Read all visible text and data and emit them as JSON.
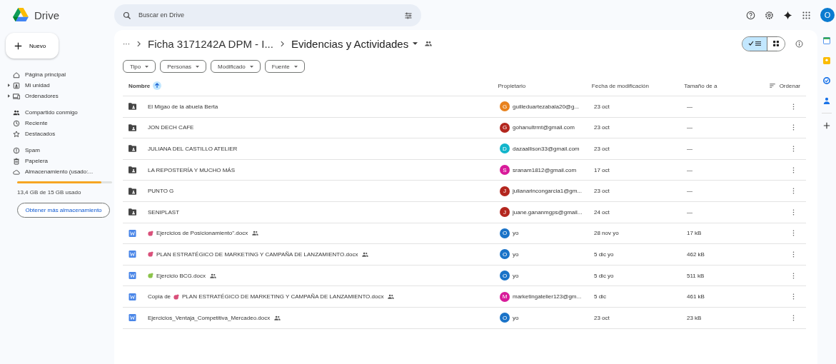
{
  "app": {
    "name": "Drive"
  },
  "search": {
    "placeholder": "Buscar en Drive"
  },
  "account": {
    "initial": "O"
  },
  "new_button": {
    "label": "Nuevo"
  },
  "sidebar": {
    "items": [
      {
        "label": "Página principal",
        "expandable": false
      },
      {
        "label": "Mi unidad",
        "expandable": true
      },
      {
        "label": "Ordenadores",
        "expandable": true
      },
      {
        "label": "Compartido conmigo",
        "expandable": false
      },
      {
        "label": "Reciente",
        "expandable": false
      },
      {
        "label": "Destacados",
        "expandable": false
      },
      {
        "label": "Spam",
        "expandable": false
      },
      {
        "label": "Papelera",
        "expandable": false
      },
      {
        "label": "Almacenamiento (usado:...",
        "expandable": false
      }
    ]
  },
  "storage": {
    "level": 0.89,
    "text": "13,4 GB de 15 GB usado",
    "button": "Obtener más almacenamiento"
  },
  "breadcrumb": {
    "more": "···",
    "parent": "Ficha 3171242A DPM - I...",
    "current": "Evidencias y Actividades"
  },
  "view_toggle": [
    {
      "kind": "list",
      "selected": true
    },
    {
      "kind": "grid",
      "selected": false
    }
  ],
  "filters": [
    "Tipo",
    "Personas",
    "Modificado",
    "Fuente"
  ],
  "table": {
    "columns": [
      "Nombre",
      "Propietario",
      "Fecha de modificación",
      "Tamaño de a",
      "Ordenar"
    ],
    "rows": [
      {
        "kind": "folder",
        "name": "El Migao de la abuela Berta",
        "shared": false,
        "owner": {
          "initial": "G",
          "color": "#e8821e",
          "label": "guilleduartezabala20@g..."
        },
        "modified": "23 oct",
        "size": "—"
      },
      {
        "kind": "folder",
        "name": "JON DECH CAFE",
        "shared": false,
        "owner": {
          "initial": "G",
          "color": "#b3261e",
          "label": "gohanultrmt@gmail.com"
        },
        "modified": "23 oct",
        "size": "—"
      },
      {
        "kind": "folder",
        "name": "JULIANA DEL CASTILLO ATELIER",
        "shared": false,
        "owner": {
          "initial": "D",
          "color": "#12b5cb",
          "label": "dazaallison33@gmail.com"
        },
        "modified": "23 oct",
        "size": "—"
      },
      {
        "kind": "folder",
        "name": "LA REPOSTERÍA Y MUCHO MÁS",
        "shared": false,
        "owner": {
          "initial": "S",
          "color": "#d81b9a",
          "label": "sranam1812@gmail.com"
        },
        "modified": "17 oct",
        "size": "—"
      },
      {
        "kind": "folder",
        "name": "PUNTO G",
        "shared": false,
        "owner": {
          "initial": "J",
          "color": "#b3261e",
          "label": "julianarincongarcia1@gm..."
        },
        "modified": "23 oct",
        "size": "—"
      },
      {
        "kind": "folder",
        "name": "SENIPLAST",
        "shared": false,
        "owner": {
          "initial": "J",
          "color": "#b3261e",
          "label": "juane.gananmgps@gmail..."
        },
        "modified": "24 oct",
        "size": "—"
      },
      {
        "kind": "doc",
        "color": "#d9507a",
        "name": "Ejercicios de Posicionamiento\".docx",
        "shared": true,
        "owner": {
          "initial": "O",
          "color": "#1a73c8",
          "label": "yo"
        },
        "modified": "28 nov yo",
        "size": "17 kB"
      },
      {
        "kind": "doc",
        "color": "#d9507a",
        "name": "PLAN ESTRATÉGICO DE MARKETING Y CAMPAÑA DE LANZAMIENTO.docx",
        "shared": true,
        "owner": {
          "initial": "O",
          "color": "#1a73c8",
          "label": "yo"
        },
        "modified": "5 dic yo",
        "size": "462 kB"
      },
      {
        "kind": "doc",
        "color": "#8bc34a",
        "name": "Ejercicio BCG.docx",
        "shared": true,
        "owner": {
          "initial": "O",
          "color": "#1a73c8",
          "label": "yo"
        },
        "modified": "5 dic yo",
        "size": "511 kB"
      },
      {
        "kind": "doc",
        "prefix": "Copia de",
        "color": "#d9507a",
        "name": "PLAN ESTRATÉGICO DE MARKETING Y CAMPAÑA DE LANZAMIENTO.docx",
        "shared": true,
        "owner": {
          "initial": "M",
          "color": "#d81b9a",
          "label": "marketingatelier123@gm..."
        },
        "modified": "5 dic",
        "size": "461 kB"
      },
      {
        "kind": "doc",
        "name": "Ejercicios_Ventaja_Competitiva_Mercadeo.docx",
        "shared": true,
        "owner": {
          "initial": "O",
          "color": "#1a73c8",
          "label": "yo"
        },
        "modified": "23 oct",
        "size": "23 kB"
      }
    ]
  }
}
